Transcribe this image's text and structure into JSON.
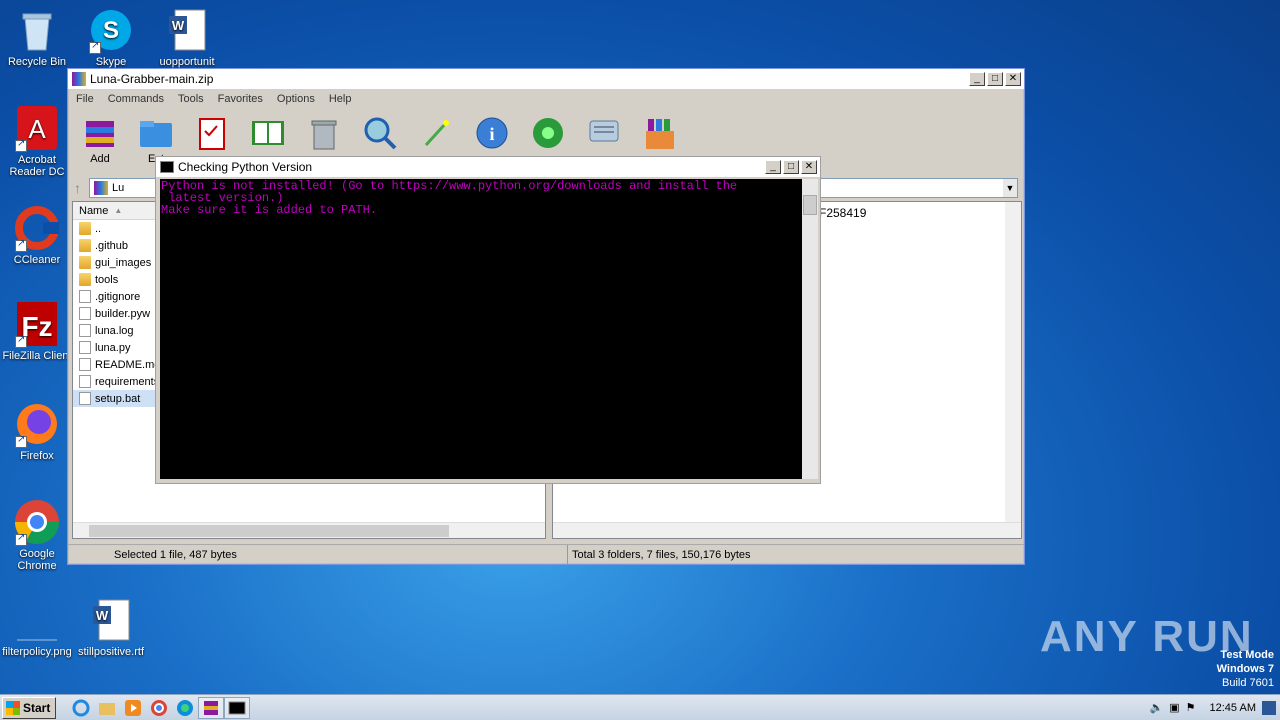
{
  "desktop": {
    "icons": [
      {
        "label": "Recycle Bin"
      },
      {
        "label": "Skype"
      },
      {
        "label": "uopportunit"
      },
      {
        "label": "Acrobat Reader DC"
      },
      {
        "label": "CCleaner"
      },
      {
        "label": "FileZilla Client"
      },
      {
        "label": "Firefox"
      },
      {
        "label": "Google Chrome"
      },
      {
        "label": "filterpolicy.png"
      },
      {
        "label": "stillpositive.rtf"
      }
    ]
  },
  "winrar": {
    "title": "Luna-Grabber-main.zip",
    "menu": [
      "File",
      "Commands",
      "Tools",
      "Favorites",
      "Options",
      "Help"
    ],
    "toolbar": {
      "add_label": "Add",
      "extract_label": "Ext"
    },
    "address": "Lu",
    "column_name": "Name",
    "files": [
      {
        "name": "..",
        "type": "folder"
      },
      {
        "name": ".github",
        "type": "folder"
      },
      {
        "name": "gui_images",
        "type": "folder"
      },
      {
        "name": "tools",
        "type": "folder"
      },
      {
        "name": ".gitignore",
        "type": "file"
      },
      {
        "name": "builder.pyw",
        "type": "file"
      },
      {
        "name": "luna.log",
        "type": "file"
      },
      {
        "name": "luna.py",
        "type": "file"
      },
      {
        "name": "README.md",
        "type": "file"
      },
      {
        "name": "requirements",
        "type": "file"
      },
      {
        "name": "setup.bat",
        "type": "file"
      }
    ],
    "right_pane_text": "F258419",
    "status_left": "Selected 1 file, 487 bytes",
    "status_right": "Total 3 folders, 7 files, 150,176 bytes"
  },
  "console": {
    "title": "Checking Python Version",
    "line1": "Python is not installed! (Go to https://www.python.org/downloads and install the",
    "line2": " latest version.)",
    "line3": "Make sure it is added to PATH."
  },
  "watermark": {
    "brand": "ANY RUN",
    "line1": "Test Mode",
    "line2": "Windows 7",
    "line3": "Build 7601"
  },
  "taskbar": {
    "start_label": "Start",
    "clock": "12:45 AM"
  }
}
